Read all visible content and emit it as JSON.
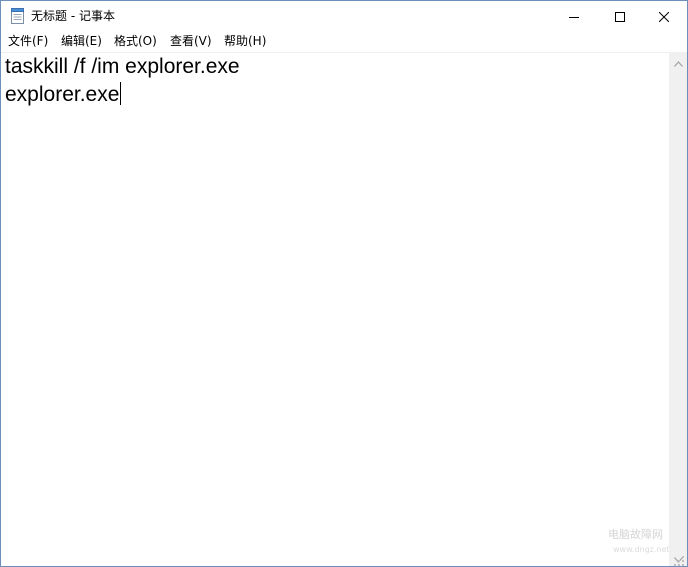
{
  "window": {
    "title": "无标题 - 记事本",
    "icon": "notepad-icon",
    "controls": {
      "minimize_icon": "minimize-icon",
      "maximize_icon": "maximize-icon",
      "close_icon": "close-icon"
    }
  },
  "menu": {
    "items": [
      {
        "label": "文件(F)"
      },
      {
        "label": "编辑(E)"
      },
      {
        "label": "格式(O)"
      },
      {
        "label": "查看(V)"
      },
      {
        "label": "帮助(H)"
      }
    ]
  },
  "editor": {
    "lines": [
      "taskkill /f /im explorer.exe",
      "explorer.exe"
    ]
  },
  "watermark": {
    "text": "电脑故障网",
    "sub": "www.dngz.net"
  },
  "colors": {
    "window_border": "#6b8fb8",
    "scrollbar_track": "#f0f0f0",
    "text": "#000000"
  }
}
